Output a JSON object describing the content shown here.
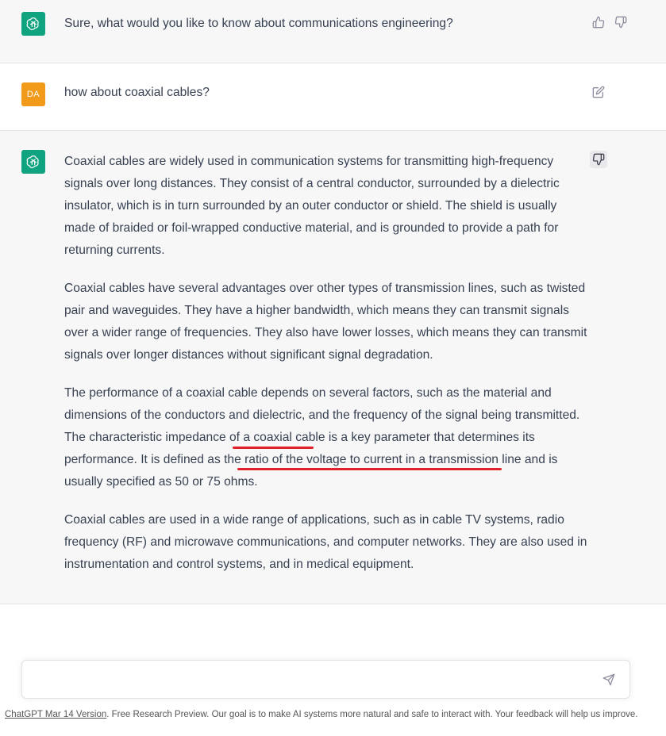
{
  "thread": {
    "msg1": {
      "role": "assistant",
      "text": "Sure, what would you like to know about communications engineering?"
    },
    "msg2": {
      "role": "user",
      "avatar_initials": "DA",
      "text": "how about coaxial cables?"
    },
    "msg3": {
      "role": "assistant",
      "p1": "Coaxial cables are widely used in communication systems for transmitting high-frequency signals over long distances. They consist of a central conductor, surrounded by a dielectric insulator, which is in turn surrounded by an outer conductor or shield. The shield is usually made of braided or foil-wrapped conductive material, and is grounded to provide a path for returning currents.",
      "p2": "Coaxial cables have several advantages over other types of transmission lines, such as twisted pair and waveguides. They have a higher bandwidth, which means they can transmit signals over a wider range of frequencies. They also have lower losses, which means they can transmit signals over longer distances without significant signal degradation.",
      "p3": "The performance of a coaxial cable depends on several factors, such as the material and dimensions of the conductors and dielectric, and the frequency of the signal being transmitted. The characteristic impedance of a coaxial cable is a key parameter that determines its performance. It is defined as the ratio of the voltage to current in a transmission line and is usually specified as 50 or 75 ohms.",
      "p4": "Coaxial cables are used in a wide range of applications, such as in cable TV systems, radio frequency (RF) and microwave communications, and computer networks. They are also used in instrumentation and control systems, and in medical equipment."
    }
  },
  "icons": {
    "gpt_logo": "openai-logo-icon",
    "thumbs_up": "thumbs-up-icon",
    "thumbs_down": "thumbs-down-icon",
    "edit": "edit-icon",
    "send": "send-icon"
  },
  "colors": {
    "assistant_bg": "#f7f7f8",
    "gpt_avatar": "#10a37f",
    "user_avatar": "#f29a1a",
    "annotation_red": "#e0202a"
  },
  "composer": {
    "placeholder": ""
  },
  "footer": {
    "link_text": "ChatGPT Mar 14 Version",
    "text": ". Free Research Preview. Our goal is to make AI systems more natural and safe to interact with. Your feedback will help us improve."
  }
}
